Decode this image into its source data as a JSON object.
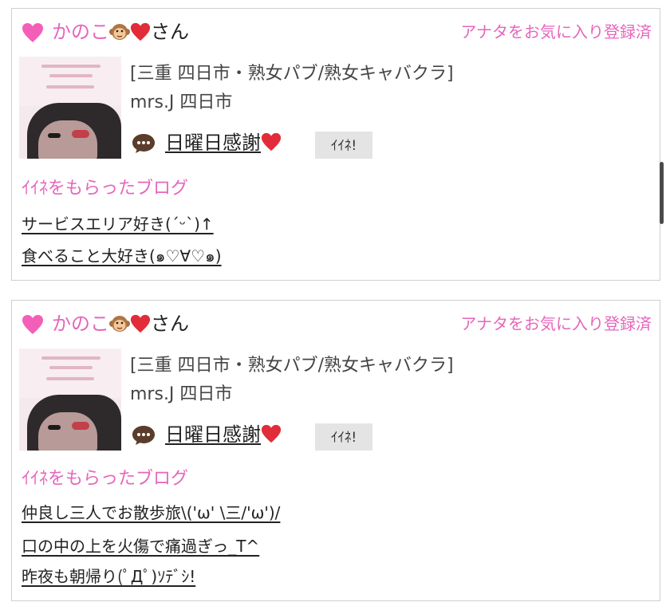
{
  "cards": [
    {
      "user_name": "かのこ",
      "user_suffix": "さん",
      "favorite_link": "アナタをお気に入り登録済",
      "shop_category": "[三重 四日市・熟女パブ/熟女キャバクラ]",
      "shop_name": "mrs.J 四日市",
      "blog_title": "日曜日感謝",
      "iine_label": "ｲｲﾈ!",
      "liked_heading": "ｲｲﾈをもらったブログ",
      "liked_posts": [
        "サービスエリア好き(ˊᵕˋ)↑",
        "食べること大好き(๑♡∀♡๑)"
      ]
    },
    {
      "user_name": "かのこ",
      "user_suffix": "さん",
      "favorite_link": "アナタをお気に入り登録済",
      "shop_category": "[三重 四日市・熟女パブ/熟女キャバクラ]",
      "shop_name": "mrs.J 四日市",
      "blog_title": "日曜日感謝",
      "iine_label": "ｲｲﾈ!",
      "liked_heading": "ｲｲﾈをもらったブログ",
      "liked_posts": [
        "仲良し三人でお散歩旅\\('ω' \\三/'ω')/",
        "口の中の上を火傷で痛過ぎっ_T^",
        "昨夜も朝帰り(ﾟДﾟ)ｿﾃﾞｼ!"
      ]
    }
  ],
  "icons": {
    "heart": "pink-heart-icon",
    "monkey": "monkey-face-icon",
    "red_heart": "red-heart-icon",
    "bubble": "speech-bubble-icon"
  },
  "colors": {
    "accent_pink": "#e666bc",
    "heart_pink": "#f35fb8",
    "red_heart": "#e12d39",
    "border": "#cfcfcf",
    "button_bg": "#e4e4e4"
  }
}
